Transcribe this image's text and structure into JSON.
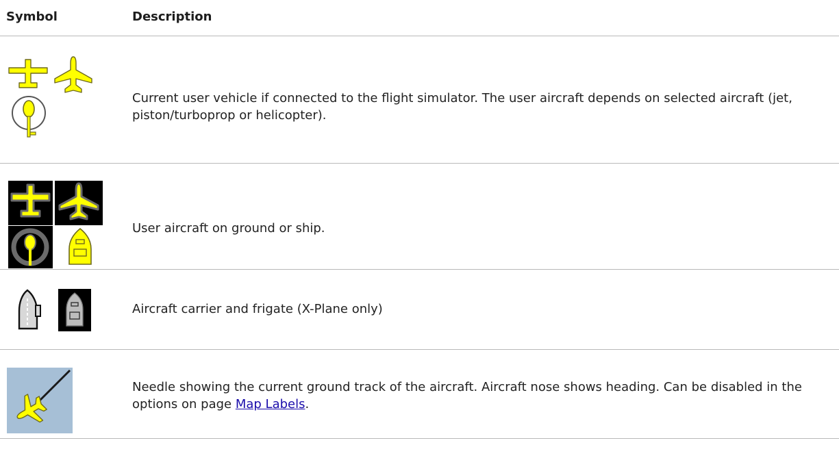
{
  "header": {
    "symbol": "Symbol",
    "description": "Description"
  },
  "rows": [
    {
      "icons": [
        "user-airplane-piston-icon",
        "user-airplane-jet-icon",
        "user-helicopter-icon"
      ],
      "description": "Current user vehicle if connected to the flight simulator. The user aircraft depends on selected aircraft (jet, piston/turboprop or helicopter)."
    },
    {
      "icons": [
        "user-airplane-piston-ground-icon",
        "user-airplane-jet-ground-icon",
        "user-helicopter-ground-icon",
        "user-ship-ground-icon"
      ],
      "description": "User aircraft on ground or ship."
    },
    {
      "icons": [
        "aircraft-carrier-icon",
        "frigate-icon"
      ],
      "description": "Aircraft carrier and frigate (X-Plane only)"
    },
    {
      "icons": [
        "ground-track-needle-icon"
      ],
      "description_before_link": "Needle showing the current ground track of the aircraft. Aircraft nose shows heading. Can be disabled in the options on page ",
      "link_text": "Map Labels",
      "description_after_link": "."
    }
  ],
  "colors": {
    "user_yellow": "#ffff00",
    "outline_dark": "#6e6a1e",
    "ground_bg": "#000000",
    "ground_ring": "#6b6b6b",
    "needle_bg": "#a6bfd6",
    "link": "#1a0dab"
  }
}
